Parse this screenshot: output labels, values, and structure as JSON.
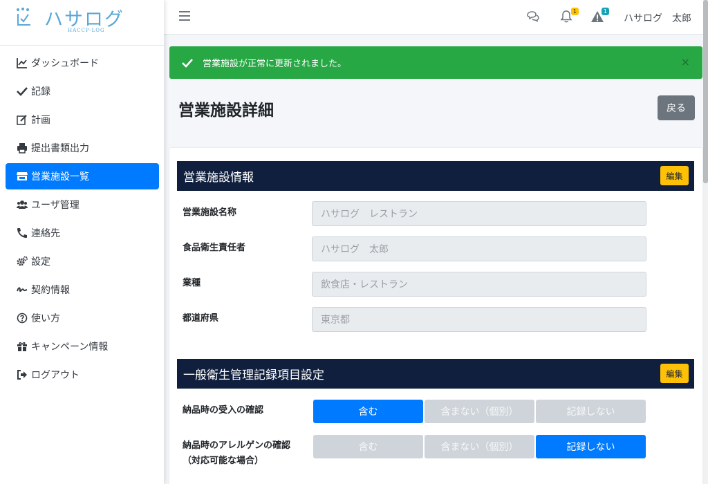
{
  "brand": {
    "name": "ハサログ",
    "sub": "HACCP-LOG"
  },
  "sidebar": {
    "items": [
      {
        "label": "ダッシュボード",
        "icon": "chart-line-icon"
      },
      {
        "label": "記録",
        "icon": "check-icon"
      },
      {
        "label": "計画",
        "icon": "edit-icon"
      },
      {
        "label": "提出書類出力",
        "icon": "printer-icon"
      },
      {
        "label": "営業施設一覧",
        "icon": "store-icon",
        "active": true
      },
      {
        "label": "ユーザ管理",
        "icon": "users-icon"
      },
      {
        "label": "連絡先",
        "icon": "phone-icon"
      },
      {
        "label": "設定",
        "icon": "cogs-icon"
      },
      {
        "label": "契約情報",
        "icon": "signature-icon"
      },
      {
        "label": "使い方",
        "icon": "question-circle-icon"
      },
      {
        "label": "キャンペーン情報",
        "icon": "gift-icon"
      },
      {
        "label": "ログアウト",
        "icon": "sign-out-icon"
      }
    ]
  },
  "header": {
    "notifications_badge": "1",
    "warnings_badge": "1",
    "user_name": "ハサログ　太郎"
  },
  "alert": {
    "message": "営業施設が正常に更新されました。",
    "close": "×"
  },
  "page": {
    "title": "営業施設詳細",
    "back_label": "戻る"
  },
  "facility_section": {
    "title": "営業施設情報",
    "edit_label": "編集",
    "fields": [
      {
        "label": "営業施設名称",
        "value": "ハサログ　レストラン"
      },
      {
        "label": "食品衛生責任者",
        "value": "ハサログ　太郎"
      },
      {
        "label": "業種",
        "value": "飲食店・レストラン"
      },
      {
        "label": "都道府県",
        "value": "東京都"
      }
    ]
  },
  "hygiene_section": {
    "title": "一般衛生管理記録項目設定",
    "edit_label": "編集",
    "rows": [
      {
        "label": "納品時の受入の確認",
        "label2": "",
        "options": [
          "含む",
          "含まない（個別）",
          "記録しない"
        ],
        "selected": 0
      },
      {
        "label": "納品時のアレルゲンの確認",
        "label2": "（対応可能な場合）",
        "options": [
          "含む",
          "含まない（個別）",
          "記録しない"
        ],
        "selected": 2
      }
    ]
  },
  "colors": {
    "primary": "#007bff",
    "success": "#28a745",
    "dark_header": "#0f1f3d",
    "warning": "#ffc107",
    "secondary": "#6c757d"
  }
}
